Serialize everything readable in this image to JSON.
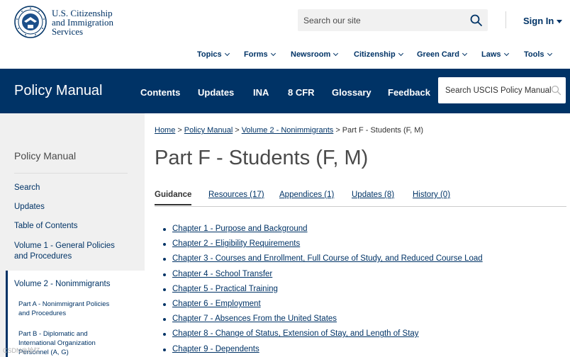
{
  "header": {
    "agency_line1": "U.S. Citizenship",
    "agency_line2": "and Immigration",
    "agency_line3": "Services",
    "search_placeholder": "Search our site",
    "signin_label": "Sign In"
  },
  "topnav": {
    "items": [
      {
        "label": "Topics"
      },
      {
        "label": "Forms"
      },
      {
        "label": "Newsroom"
      },
      {
        "label": "Citizenship"
      },
      {
        "label": "Green Card"
      },
      {
        "label": "Laws"
      },
      {
        "label": "Tools"
      }
    ]
  },
  "policy_bar": {
    "title": "Policy Manual",
    "links": [
      {
        "label": "Contents"
      },
      {
        "label": "Updates"
      },
      {
        "label": "INA"
      },
      {
        "label": "8 CFR"
      },
      {
        "label": "Glossary"
      },
      {
        "label": "Feedback"
      }
    ],
    "search_placeholder": "Search USCIS Policy Manual"
  },
  "sidebar": {
    "title": "Policy Manual",
    "links": [
      {
        "label": "Search"
      },
      {
        "label": "Updates"
      },
      {
        "label": "Table of Contents"
      },
      {
        "label": "Volume 1 - General Policies and Procedures"
      }
    ],
    "active_volume": "Volume 2 - Nonimmigrants",
    "parts": [
      {
        "label": "Part A - Nonimmigrant Policies and Procedures"
      },
      {
        "label": "Part B - Diplomatic and International Organization Personnel (A, G)"
      }
    ]
  },
  "breadcrumb": {
    "home": "Home",
    "policy_manual": "Policy Manual",
    "volume": "Volume 2 - Nonimmigrants",
    "current": "Part F - Students (F, M)",
    "separator": ">"
  },
  "main": {
    "title": "Part F - Students (F, M)",
    "tabs": [
      {
        "label": "Guidance",
        "active": true
      },
      {
        "label": "Resources (17)"
      },
      {
        "label": "Appendices (1)"
      },
      {
        "label": "Updates (8)"
      },
      {
        "label": "History (0)"
      }
    ],
    "chapters": [
      {
        "label": "Chapter 1 - Purpose and Background"
      },
      {
        "label": "Chapter 2 - Eligibility Requirements"
      },
      {
        "label": "Chapter 3 - Courses and Enrollment, Full Course of Study, and Reduced Course Load"
      },
      {
        "label": "Chapter 4 - School Transfer"
      },
      {
        "label": "Chapter 5 - Practical Training"
      },
      {
        "label": "Chapter 6 - Employment"
      },
      {
        "label": "Chapter 7 - Absences From the United States"
      },
      {
        "label": "Chapter 8 - Change of Status, Extension of Stay, and Length of Stay"
      },
      {
        "label": "Chapter 9 - Dependents"
      }
    ]
  },
  "colors": {
    "brand_navy": "#003366",
    "sidebar_bg": "#f0f0f0",
    "title_gray": "#4a4a4a"
  },
  "watermark": "CSDN@拾忆"
}
